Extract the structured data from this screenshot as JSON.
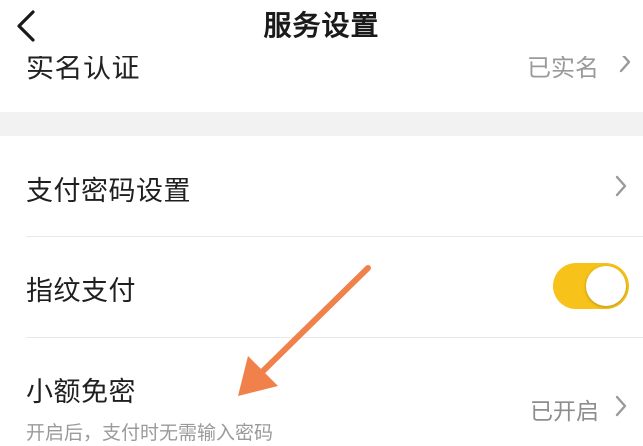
{
  "header": {
    "title": "服务设置"
  },
  "rows": {
    "clipped": {
      "label": "实名认证",
      "value": "已实名"
    },
    "pay_password": {
      "label": "支付密码设置"
    },
    "fingerprint": {
      "label": "指纹支付",
      "toggle_on": true
    },
    "small_no_pwd": {
      "label": "小额免密",
      "subtitle": "开启后，支付时无需输入密码",
      "value": "已开启"
    }
  },
  "colors": {
    "toggle_on": "#f7c21a",
    "annotation_arrow": "#f0814a",
    "section_gap": "#f2f2f2"
  },
  "icons": {
    "back": "chevron-left-icon",
    "row_arrow": "chevron-right-icon"
  }
}
